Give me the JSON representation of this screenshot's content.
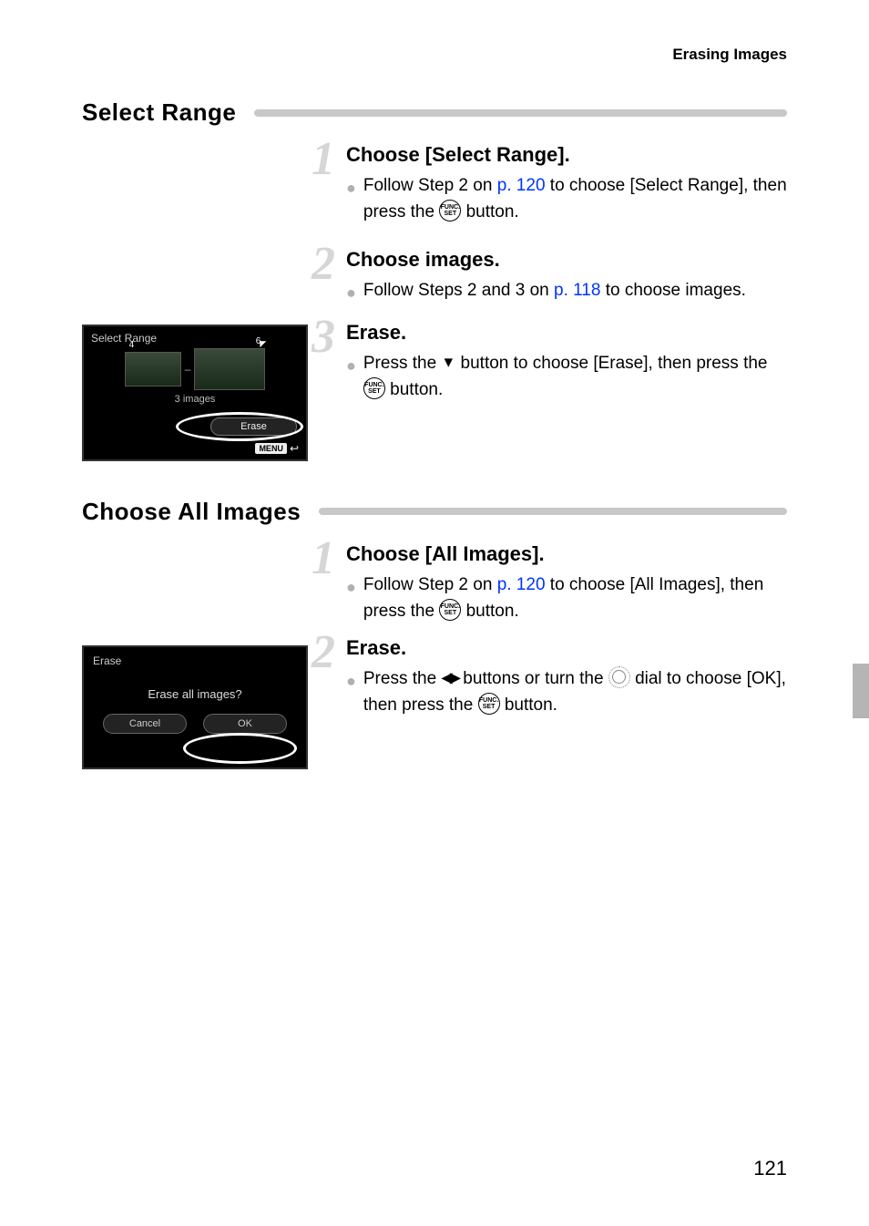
{
  "header": {
    "title": "Erasing Images"
  },
  "section1": {
    "heading": "Select Range",
    "steps": [
      {
        "num": "1",
        "title": "Choose [Select Range].",
        "bullet_pre": "Follow Step 2 on ",
        "link": "p. 120",
        "bullet_mid": " to choose [Select Range], then press the ",
        "icon": "FUNC SET",
        "bullet_post": " button."
      },
      {
        "num": "2",
        "title": "Choose images.",
        "bullet_pre": "Follow Steps 2 and 3 on ",
        "link": "p. 118",
        "bullet_post": " to choose images."
      },
      {
        "num": "3",
        "title": "Erase.",
        "bullet_pre": "Press the ",
        "arrow": "▼",
        "bullet_mid": " button to choose [Erase], then press the ",
        "icon": "FUNC SET",
        "bullet_post": " button."
      }
    ],
    "cam": {
      "title": "Select Range",
      "left_num": "4",
      "right_num": "6",
      "count": "3 images",
      "erase": "Erase",
      "menu": "MENU"
    }
  },
  "section2": {
    "heading": "Choose All Images",
    "steps": [
      {
        "num": "1",
        "title": "Choose [All Images].",
        "bullet_pre": "Follow Step 2 on ",
        "link": "p. 120",
        "bullet_mid": " to choose [All Images], then press the ",
        "icon": "FUNC SET",
        "bullet_post": " button."
      },
      {
        "num": "2",
        "title": "Erase.",
        "bullet_pre": "Press the ",
        "arrows": "◀▶",
        "bullet_mid1": " buttons or turn the ",
        "dial": "dial",
        "bullet_mid2": " dial to choose [OK], then press the ",
        "icon": "FUNC SET",
        "bullet_post": " button."
      }
    ],
    "cam": {
      "title": "Erase",
      "question": "Erase all images?",
      "cancel": "Cancel",
      "ok": "OK"
    }
  },
  "page_number": "121",
  "funcset": {
    "top": "FUNC.",
    "bottom": "SET"
  }
}
